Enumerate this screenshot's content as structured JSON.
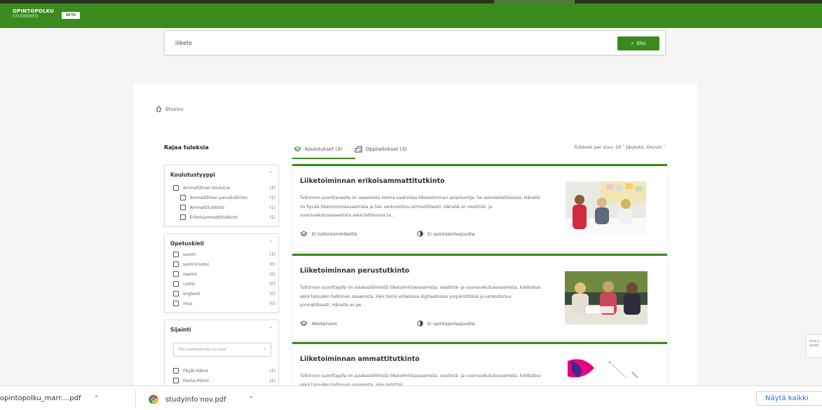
{
  "header": {
    "logo_line1": "OPINTOPOLKU",
    "logo_line2": "STUDIEINFO",
    "beta": "BETA"
  },
  "search": {
    "value": "liiketo",
    "button_label": "Etsi"
  },
  "breadcrumb": {
    "home": "Etusivu"
  },
  "filters": {
    "title": "Rajaa tuloksia",
    "koulutustyyppi": {
      "title": "Koulutustyyppi",
      "items": [
        {
          "label": "Ammatillinen koulutus",
          "count": "(3)"
        },
        {
          "label": "Ammatillinen perustutkinto",
          "count": "(1)"
        },
        {
          "label": "Ammattitutkinto",
          "count": "(1)"
        },
        {
          "label": "Erikoisammattitutkinto",
          "count": "(1)"
        }
      ]
    },
    "opetuskieli": {
      "title": "Opetuskieli",
      "items": [
        {
          "label": "suomi",
          "count": "(3)"
        },
        {
          "label": "suomi/ruotsi",
          "count": "(0)"
        },
        {
          "label": "saame",
          "count": "(0)"
        },
        {
          "label": "ruotsi",
          "count": "(0)"
        },
        {
          "label": "englanti",
          "count": "(0)"
        },
        {
          "label": "muu",
          "count": "(0)"
        }
      ]
    },
    "sijainti": {
      "title": "Sijainti",
      "placeholder": "Etsi paikkakunta tai alue",
      "items": [
        {
          "label": "Päijät-Häme",
          "count": "(3)"
        },
        {
          "label": "Kanta-Häme",
          "count": "(2)"
        }
      ]
    }
  },
  "tabs": [
    {
      "label": "Koulutukset (3)"
    },
    {
      "label": "Oppilaitokset (3)"
    }
  ],
  "controls": {
    "text": "Tulokset per sivu: 20 ˅  Järjestä: Osuvin ˅"
  },
  "results": [
    {
      "title": "Liiketoiminnan erikoisammattitutkinto",
      "desc": "Tutkinnon suorittaneella on osaamista toimia vaativissa liiketoiminnan asiantuntija- tai esimiestehtävissä. Hänellä on hyvää liiketoimintaosaamista ja hän verkostoituu ammatillisesti. Hänellä on viestintä- ja vuorovaikutusosaamista sekä tehtävissä ta...",
      "meta1": "Ei tutkintonimikettä",
      "meta2": "Ei opintojenlaajuutta"
    },
    {
      "title": "Liiketoiminnan perustutkinto",
      "desc": "Tutkinnon suorittajalla on asiakaslähtöistä liiketoimintaosaamista, viestintä- ja vuorovaikutusosaamista, kielitaitoa sekä talouden hallinnan osaamista. Hän toimii erilaisissa digitaalisissa ympäristöissä ja verkostoituu ammatillisesti. Hänellä on pe...",
      "meta1": "Merkonomi",
      "meta2": "Ei opintojenlaajuutta"
    },
    {
      "title": "Liiketoiminnan ammattitutkinto",
      "desc": "Tutkinnon suorittajalla on asiakaslähtöistä liiketoimintaosaamista, viestintä- ja vuorovaikutusosaamista, kielitaitoa sekä talouden hallinnan osaamista. Hän kehittää"
    }
  ],
  "downloads": [
    {
      "name": "opintopolku_marr....pdf"
    },
    {
      "name": "studyinfo nov.pdf"
    }
  ],
  "show_all": "Näytä kaikki",
  "feedback": {
    "line1": "Anna p",
    "line2": "Opinto"
  },
  "colors": {
    "brand_green": "#3a8a1e",
    "link_blue": "#1a73e8"
  }
}
